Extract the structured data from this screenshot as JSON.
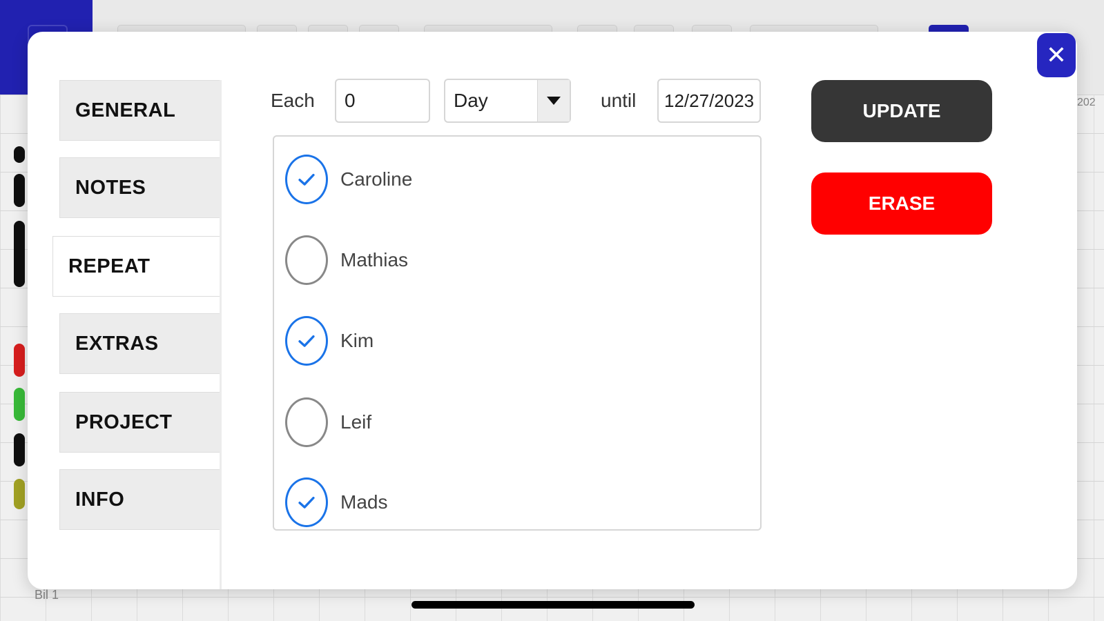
{
  "background": {
    "footer_label": "Bil 1",
    "date_strip": "202"
  },
  "modal": {
    "close_icon": "close-icon",
    "tabs": [
      {
        "label": "GENERAL",
        "active": false
      },
      {
        "label": "NOTES",
        "active": false
      },
      {
        "label": "REPEAT",
        "active": true
      },
      {
        "label": "EXTRAS",
        "active": false
      },
      {
        "label": "PROJECT",
        "active": false
      },
      {
        "label": "INFO",
        "active": false
      }
    ],
    "repeat": {
      "each_label": "Each",
      "interval_value": "0",
      "unit_value": "Day",
      "until_label": "until",
      "until_date": "12/27/2023",
      "people": [
        {
          "name": "Caroline",
          "checked": true
        },
        {
          "name": "Mathias",
          "checked": false
        },
        {
          "name": "Kim",
          "checked": true
        },
        {
          "name": "Leif",
          "checked": false
        },
        {
          "name": "Mads",
          "checked": true
        }
      ]
    },
    "actions": {
      "update_label": "UPDATE",
      "erase_label": "ERASE"
    }
  },
  "colors": {
    "accent": "#2626c0",
    "check": "#1a73e8",
    "update": "#363636",
    "erase": "#ff0000"
  }
}
